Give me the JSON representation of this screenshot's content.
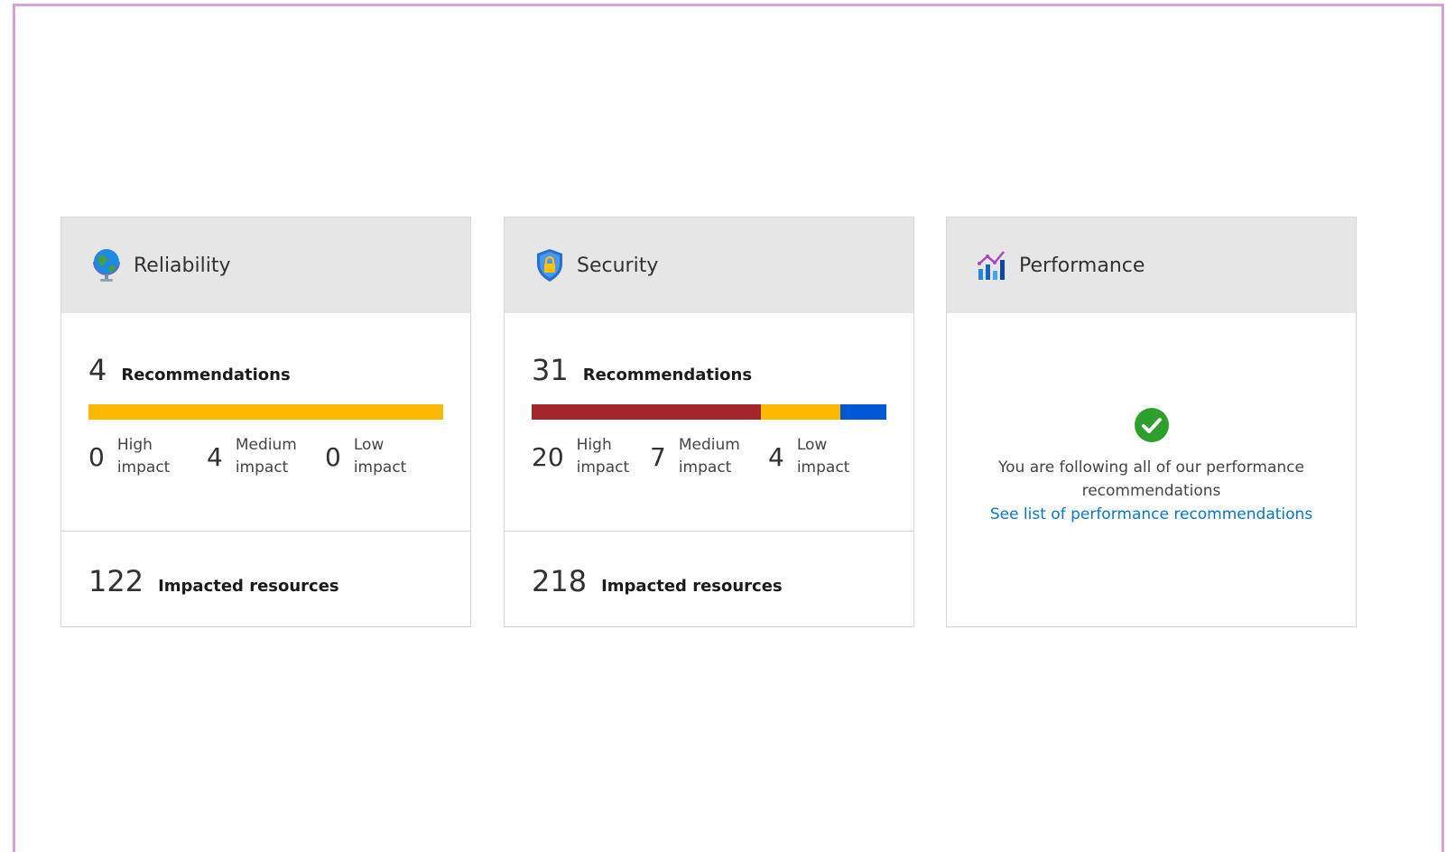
{
  "colors": {
    "high": "#a4262c",
    "medium": "#fcb900",
    "low": "#0058d6",
    "success": "#2ca02c",
    "link": "#0078d4"
  },
  "reliability": {
    "title": "Reliability",
    "icon": "globe-icon",
    "recommendations_count": "4",
    "recommendations_label": "Recommendations",
    "impacts": [
      {
        "count": "0",
        "label": "High impact",
        "value": 0
      },
      {
        "count": "4",
        "label": "Medium impact",
        "value": 4
      },
      {
        "count": "0",
        "label": "Low impact",
        "value": 0
      }
    ],
    "impacted_count": "122",
    "impacted_label": "Impacted resources"
  },
  "security": {
    "title": "Security",
    "icon": "shield-lock-icon",
    "recommendations_count": "31",
    "recommendations_label": "Recommendations",
    "impacts": [
      {
        "count": "20",
        "label": "High impact",
        "value": 20
      },
      {
        "count": "7",
        "label": "Medium impact",
        "value": 7
      },
      {
        "count": "4",
        "label": "Low impact",
        "value": 4
      }
    ],
    "impacted_count": "218",
    "impacted_label": "Impacted resources"
  },
  "performance": {
    "title": "Performance",
    "icon": "bar-chart-icon",
    "status_icon": "checkmark-circle-icon",
    "message": "You are following all of our performance recommendations",
    "link_text": "See list of performance recommendations"
  }
}
